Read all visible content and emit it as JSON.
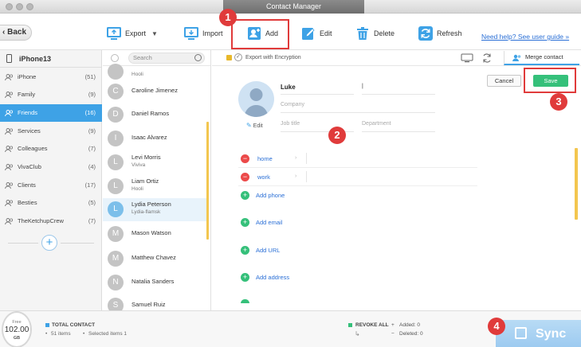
{
  "window": {
    "title": "Contact Manager"
  },
  "toolbar": {
    "back_label": "Back",
    "export_label": "Export",
    "import_label": "Import",
    "add_label": "Add",
    "edit_label": "Edit",
    "delete_label": "Delete",
    "refresh_label": "Refresh",
    "help_link": "Need help? See user guide »"
  },
  "callouts": [
    "1",
    "2",
    "3",
    "4"
  ],
  "sidebar": {
    "device": "iPhone13",
    "groups": [
      {
        "label": "iPhone",
        "count": "(51)"
      },
      {
        "label": "Family",
        "count": "(9)"
      },
      {
        "label": "Friends",
        "count": "(16)",
        "active": true
      },
      {
        "label": "Services",
        "count": "(9)"
      },
      {
        "label": "Colleagues",
        "count": "(7)"
      },
      {
        "label": "VivaClub",
        "count": "(4)"
      },
      {
        "label": "Clients",
        "count": "(17)"
      },
      {
        "label": "Besties",
        "count": "(5)"
      },
      {
        "label": "TheKetchupCrew",
        "count": "(7)"
      }
    ],
    "add_group_symbol": "+"
  },
  "list": {
    "search_placeholder": "Search",
    "contacts": [
      {
        "initial": "",
        "name": "",
        "sub": "Hooli"
      },
      {
        "initial": "C",
        "name": "Caroline Jimenez",
        "sub": ""
      },
      {
        "initial": "D",
        "name": "Daniel Ramos",
        "sub": ""
      },
      {
        "initial": "I",
        "name": "Isaac Alvarez",
        "sub": ""
      },
      {
        "initial": "L",
        "name": "Levi Morris",
        "sub": "Viviva"
      },
      {
        "initial": "L",
        "name": "Liam Ortiz",
        "sub": "Hooli"
      },
      {
        "initial": "L",
        "name": "Lydia Peterson",
        "sub": "Lydia-flamsk",
        "selected": true
      },
      {
        "initial": "M",
        "name": "Mason Watson",
        "sub": ""
      },
      {
        "initial": "M",
        "name": "Matthew Chavez",
        "sub": ""
      },
      {
        "initial": "N",
        "name": "Natalia Sanders",
        "sub": ""
      },
      {
        "initial": "S",
        "name": "Samuel Ruiz",
        "sub": ""
      }
    ]
  },
  "main": {
    "encryption_label": "Export with Encryption",
    "merge_label": "Merge contact",
    "cancel_label": "Cancel",
    "save_label": "Save",
    "edit_photo_label": "Edit",
    "first_name": "Luke",
    "company_placeholder": "Company",
    "job_title_placeholder": "Job title",
    "department_placeholder": "Department",
    "phone_rows": [
      "home",
      "work"
    ],
    "add_phone": "Add phone",
    "add_email": "Add email",
    "add_url": "Add URL",
    "add_address": "Add address"
  },
  "bottom": {
    "storage_free_label": "Free",
    "storage_value": "102.00",
    "storage_unit": "GB",
    "total_contact_label": "TOTAL CONTACT",
    "items_count": "51 items",
    "selected_items": "Selected items 1",
    "revoke_all_label": "REVOKE ALL",
    "added": "Added: 0",
    "deleted": "Deleted: 0",
    "sync_label": "Sync"
  },
  "colors": {
    "accent": "#3ea2e6",
    "save_green": "#35c07a",
    "callout_red": "#e03b3b",
    "scroll_yellow": "#f3c64f"
  }
}
